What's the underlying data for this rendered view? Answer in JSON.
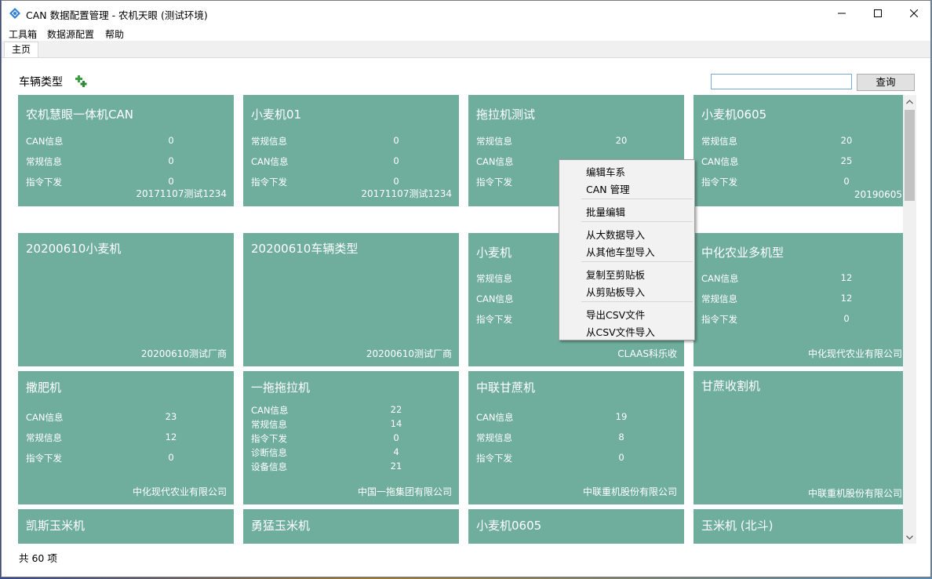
{
  "window": {
    "title": "CAN 数据配置管理 - 农机天眼 (测试环境)"
  },
  "menubar": [
    {
      "label": "工具箱"
    },
    {
      "label": "数据源配置"
    },
    {
      "label": "帮助"
    }
  ],
  "tabs": [
    {
      "label": "主页"
    }
  ],
  "toolbar": {
    "header_label": "车辆类型",
    "search_value": "",
    "search_button": "查询"
  },
  "cards": [
    {
      "title": "农机慧眼一体机CAN",
      "stats": [
        [
          "CAN信息",
          "0"
        ],
        [
          "常规信息",
          "0"
        ],
        [
          "指令下发",
          "0"
        ]
      ],
      "footer": "20171107测试1234"
    },
    {
      "title": "小麦机01",
      "stats": [
        [
          "常规信息",
          "0"
        ],
        [
          "CAN信息",
          "0"
        ],
        [
          "指令下发",
          "0"
        ]
      ],
      "footer": "20171107测试1234"
    },
    {
      "title": "拖拉机测试",
      "stats": [
        [
          "常规信息",
          "20"
        ],
        [
          "CAN信息",
          ""
        ],
        [
          "指令下发",
          ""
        ]
      ],
      "footer": ""
    },
    {
      "title": "小麦机0605",
      "stats": [
        [
          "常规信息",
          "20"
        ],
        [
          "CAN信息",
          "25"
        ],
        [
          "指令下发",
          "0"
        ]
      ],
      "footer": "20190605"
    },
    {
      "title": "20200610小麦机",
      "stats": [],
      "footer": "20200610测试厂商"
    },
    {
      "title": "20200610车辆类型",
      "stats": [],
      "footer": "20200610测试厂商"
    },
    {
      "title": "小麦机",
      "stats": [
        [
          "常规信息",
          ""
        ],
        [
          "CAN信息",
          ""
        ],
        [
          "指令下发",
          ""
        ]
      ],
      "footer": "CLAAS科乐收"
    },
    {
      "title": "中化农业多机型",
      "stats": [
        [
          "CAN信息",
          "12"
        ],
        [
          "常规信息",
          "12"
        ],
        [
          "指令下发",
          "0"
        ]
      ],
      "footer": "中化现代农业有限公司"
    },
    {
      "title": "撒肥机",
      "stats": [
        [
          "CAN信息",
          "23"
        ],
        [
          "常规信息",
          "12"
        ],
        [
          "指令下发",
          "0"
        ]
      ],
      "footer": "中化现代农业有限公司"
    },
    {
      "title": "一拖拖拉机",
      "stats": [
        [
          "CAN信息",
          "22"
        ],
        [
          "常规信息",
          "14"
        ],
        [
          "指令下发",
          "0"
        ],
        [
          "诊断信息",
          "4"
        ],
        [
          "设备信息",
          "21"
        ]
      ],
      "footer": "中国一拖集团有限公司"
    },
    {
      "title": "中联甘蔗机",
      "stats": [
        [
          "CAN信息",
          "19"
        ],
        [
          "常规信息",
          "8"
        ],
        [
          "指令下发",
          "0"
        ]
      ],
      "footer": "中联重机股份有限公司"
    },
    {
      "title": "甘蔗收割机",
      "stats": [],
      "footer": "中联重机股份有限公司"
    },
    {
      "title": "凯斯玉米机",
      "stats": [],
      "footer": ""
    },
    {
      "title": "勇猛玉米机",
      "stats": [],
      "footer": ""
    },
    {
      "title": "小麦机0605",
      "stats": [],
      "footer": ""
    },
    {
      "title": "玉米机 (北斗)",
      "stats": [],
      "footer": ""
    }
  ],
  "context_menu": {
    "items": [
      {
        "label": "编辑车系",
        "group": 0
      },
      {
        "label": "CAN 管理",
        "group": 0
      },
      {
        "label": "批量编辑",
        "group": 1
      },
      {
        "label": "从大数据导入",
        "group": 2
      },
      {
        "label": "从其他车型导入",
        "group": 2
      },
      {
        "label": "复制至剪贴板",
        "group": 3
      },
      {
        "label": "从剪贴板导入",
        "group": 3
      },
      {
        "label": "导出CSV文件",
        "group": 4
      },
      {
        "label": "从CSV文件导入",
        "group": 4
      }
    ]
  },
  "status": {
    "count_text": "共 60 项"
  },
  "colors": {
    "card": "#6fae9c",
    "menu_bg": "#f2f2f2",
    "accent": "#0078d7"
  }
}
